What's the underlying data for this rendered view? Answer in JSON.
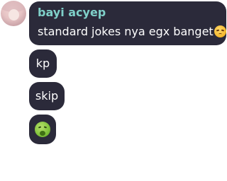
{
  "chat": {
    "author": "bayi acyep",
    "messages": [
      {
        "text": "standard jokes nya egx banget",
        "emoji": "unamused-face"
      },
      {
        "text": "kp"
      },
      {
        "text": "skip"
      },
      {
        "text": "",
        "emoji": "nauseated-face"
      }
    ]
  },
  "colors": {
    "bubble": "#2b2a3a",
    "username": "#7fd0c9",
    "text": "#ffffff"
  }
}
